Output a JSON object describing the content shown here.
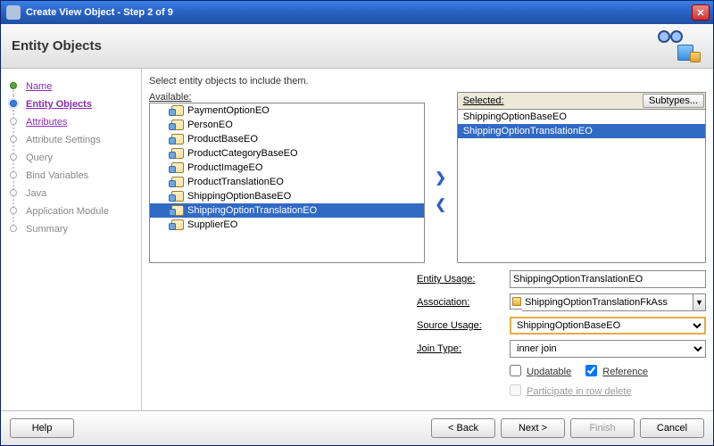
{
  "window": {
    "title": "Create View Object - Step 2 of 9"
  },
  "header": {
    "title": "Entity Objects"
  },
  "wizard": [
    {
      "label": "Name",
      "state": "done link"
    },
    {
      "label": "Entity Objects",
      "state": "active"
    },
    {
      "label": "Attributes",
      "state": "link"
    },
    {
      "label": "Attribute Settings",
      "state": ""
    },
    {
      "label": "Query",
      "state": ""
    },
    {
      "label": "Bind Variables",
      "state": ""
    },
    {
      "label": "Java",
      "state": ""
    },
    {
      "label": "Application Module",
      "state": ""
    },
    {
      "label": "Summary",
      "state": ""
    }
  ],
  "main": {
    "instruction": "Select entity objects to include them.",
    "available_label": "Available:",
    "selected_label": "Selected:",
    "subtypes_button": "Subtypes...",
    "available": [
      {
        "label": "PaymentOptionEO",
        "selected": false
      },
      {
        "label": "PersonEO",
        "selected": false
      },
      {
        "label": "ProductBaseEO",
        "selected": false
      },
      {
        "label": "ProductCategoryBaseEO",
        "selected": false
      },
      {
        "label": "ProductImageEO",
        "selected": false
      },
      {
        "label": "ProductTranslationEO",
        "selected": false
      },
      {
        "label": "ShippingOptionBaseEO",
        "selected": false
      },
      {
        "label": "ShippingOptionTranslationEO",
        "selected": true
      },
      {
        "label": "SupplierEO",
        "selected": false
      }
    ],
    "selected": [
      {
        "label": "ShippingOptionBaseEO",
        "selected": false
      },
      {
        "label": "ShippingOptionTranslationEO",
        "selected": true
      }
    ]
  },
  "form": {
    "entity_usage_label": "Entity Usage:",
    "entity_usage_value": "ShippingOptionTranslationEO",
    "association_label": "Association:",
    "association_value": "ShippingOptionTranslationFkAss",
    "source_usage_label": "Source Usage:",
    "source_usage_value": "ShippingOptionBaseEO",
    "join_type_label": "Join Type:",
    "join_type_value": "inner join",
    "updatable_label": "Updatable",
    "updatable_checked": false,
    "reference_label": "Reference",
    "reference_checked": true,
    "participate_label": "Participate in row delete",
    "participate_enabled": false
  },
  "footer": {
    "help": "Help",
    "back": "< Back",
    "next": "Next >",
    "finish": "Finish",
    "cancel": "Cancel",
    "finish_enabled": false
  }
}
